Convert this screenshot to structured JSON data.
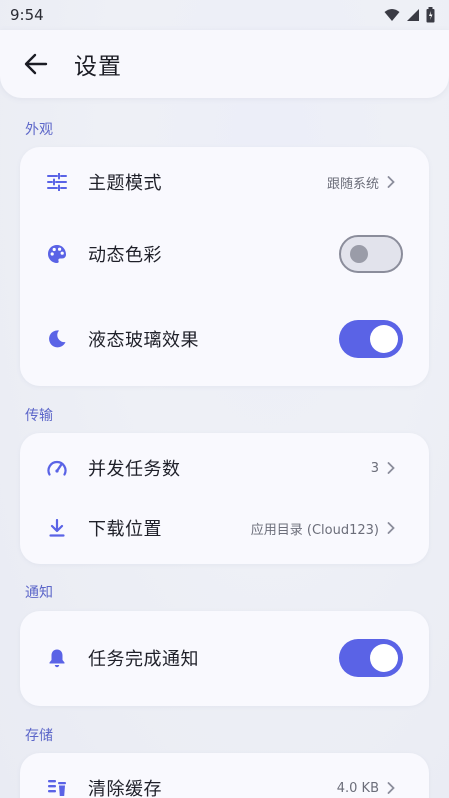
{
  "status_bar": {
    "time": "9:54"
  },
  "app_bar": {
    "title": "设置"
  },
  "sections": {
    "appearance": {
      "title": "外观",
      "theme": {
        "label": "主题模式",
        "value": "跟随系统"
      },
      "dynamic_color": {
        "label": "动态色彩",
        "enabled": false
      },
      "liquid_glass": {
        "label": "液态玻璃效果",
        "enabled": true
      }
    },
    "transfer": {
      "title": "传输",
      "concurrency": {
        "label": "并发任务数",
        "value": "3"
      },
      "download_location": {
        "label": "下载位置",
        "value": "应用目录 (Cloud123)"
      }
    },
    "notification": {
      "title": "通知",
      "task_complete": {
        "label": "任务完成通知",
        "enabled": true
      }
    },
    "storage": {
      "title": "存储",
      "clear_cache": {
        "label": "清除缓存",
        "value": "4.0 KB"
      }
    }
  },
  "colors": {
    "accent": "#5a63e6",
    "section_label": "#5d67c9"
  }
}
